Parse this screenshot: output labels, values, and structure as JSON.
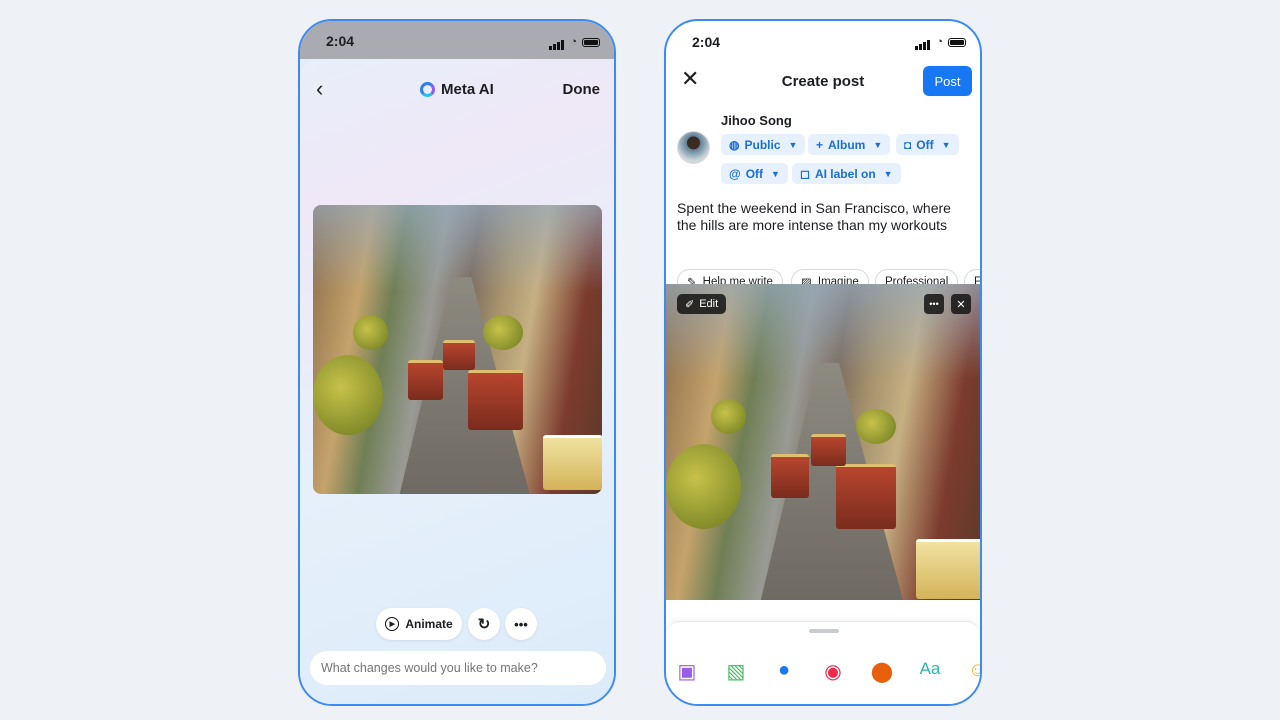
{
  "left_phone": {
    "status_time": "2:04",
    "header": {
      "back_icon": "chevron-left-icon",
      "title": "Meta AI",
      "done_label": "Done"
    },
    "image_alt": "AI-generated San Francisco street with cable cars",
    "actions": {
      "animate_label": "Animate",
      "regenerate_icon": "refresh-icon",
      "more_icon": "more-icon"
    },
    "prompt_input": {
      "placeholder": "What changes would you like to make?",
      "value": ""
    }
  },
  "right_phone": {
    "status_time": "2:04",
    "header": {
      "close_icon": "close-icon",
      "title": "Create post",
      "post_label": "Post"
    },
    "user": {
      "name": "Jihoo Song"
    },
    "chips": [
      {
        "icon": "globe-icon",
        "label": "Public"
      },
      {
        "icon": "plus-icon",
        "label": "Album"
      },
      {
        "icon": "instagram-icon",
        "label": "Off"
      },
      {
        "icon": "threads-icon",
        "label": "Off"
      },
      {
        "icon": "ai-label-icon",
        "label": "AI label on"
      }
    ],
    "post_text": "Spent the weekend in San Francisco, where the hills are more intense than my workouts",
    "tools": [
      "Help me write",
      "Imagine",
      "Professional",
      "F"
    ],
    "image_overlay": {
      "edit_label": "Edit"
    },
    "bottom_toolbar": [
      "ai-image-icon",
      "photo-icon",
      "tag-people-icon",
      "live-video-icon",
      "location-icon",
      "text-style-icon",
      "emoji-icon"
    ],
    "colors": {
      "accent": "#1877f2",
      "frame": "#3d8bf2"
    }
  }
}
